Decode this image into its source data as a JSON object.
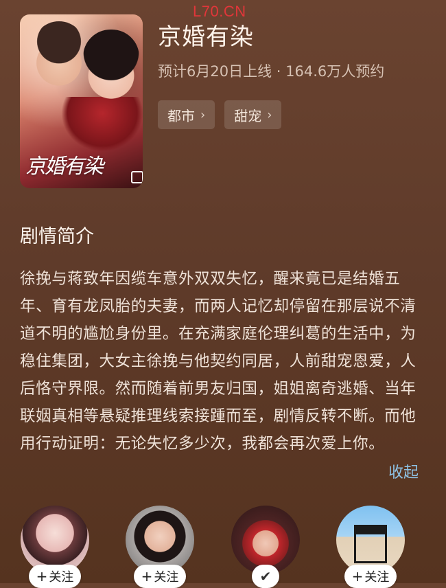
{
  "watermark": "L70.CN",
  "drama": {
    "title": "京婚有染",
    "meta": "预计6月20日上线 · 164.6万人预约",
    "tags": [
      {
        "label": "都市"
      },
      {
        "label": "甜宠"
      }
    ],
    "poster": {
      "title_art": "京婚有染"
    }
  },
  "synopsis": {
    "heading": "剧情简介",
    "text": "徐挽与蒋致年因缆车意外双双失忆，醒来竟已是结婚五年、育有龙凤胎的夫妻，而两人记忆却停留在那层说不清道不明的尴尬身份里。在充满家庭伦理纠葛的生活中，为稳住集团，大女主徐挽与他契约同居，人前甜宠恩爱，人后恪守界限。然而随着前男友归国，姐姐离奇逃婚、当年联姻真相等悬疑推理线索接踵而至，剧情反转不断。而他用行动证明：无论失忆多少次，我都会再次爱上你。",
    "collapse_label": "收起"
  },
  "cast": [
    {
      "follow_label": "关注",
      "followed": false
    },
    {
      "follow_label": "关注",
      "followed": false
    },
    {
      "follow_label": "",
      "followed": true
    },
    {
      "follow_label": "关注",
      "followed": false
    }
  ],
  "icons": {
    "tag_chevron": "chevron-right-icon",
    "follow_plus": "plus-icon",
    "followed_check": "check-icon"
  }
}
